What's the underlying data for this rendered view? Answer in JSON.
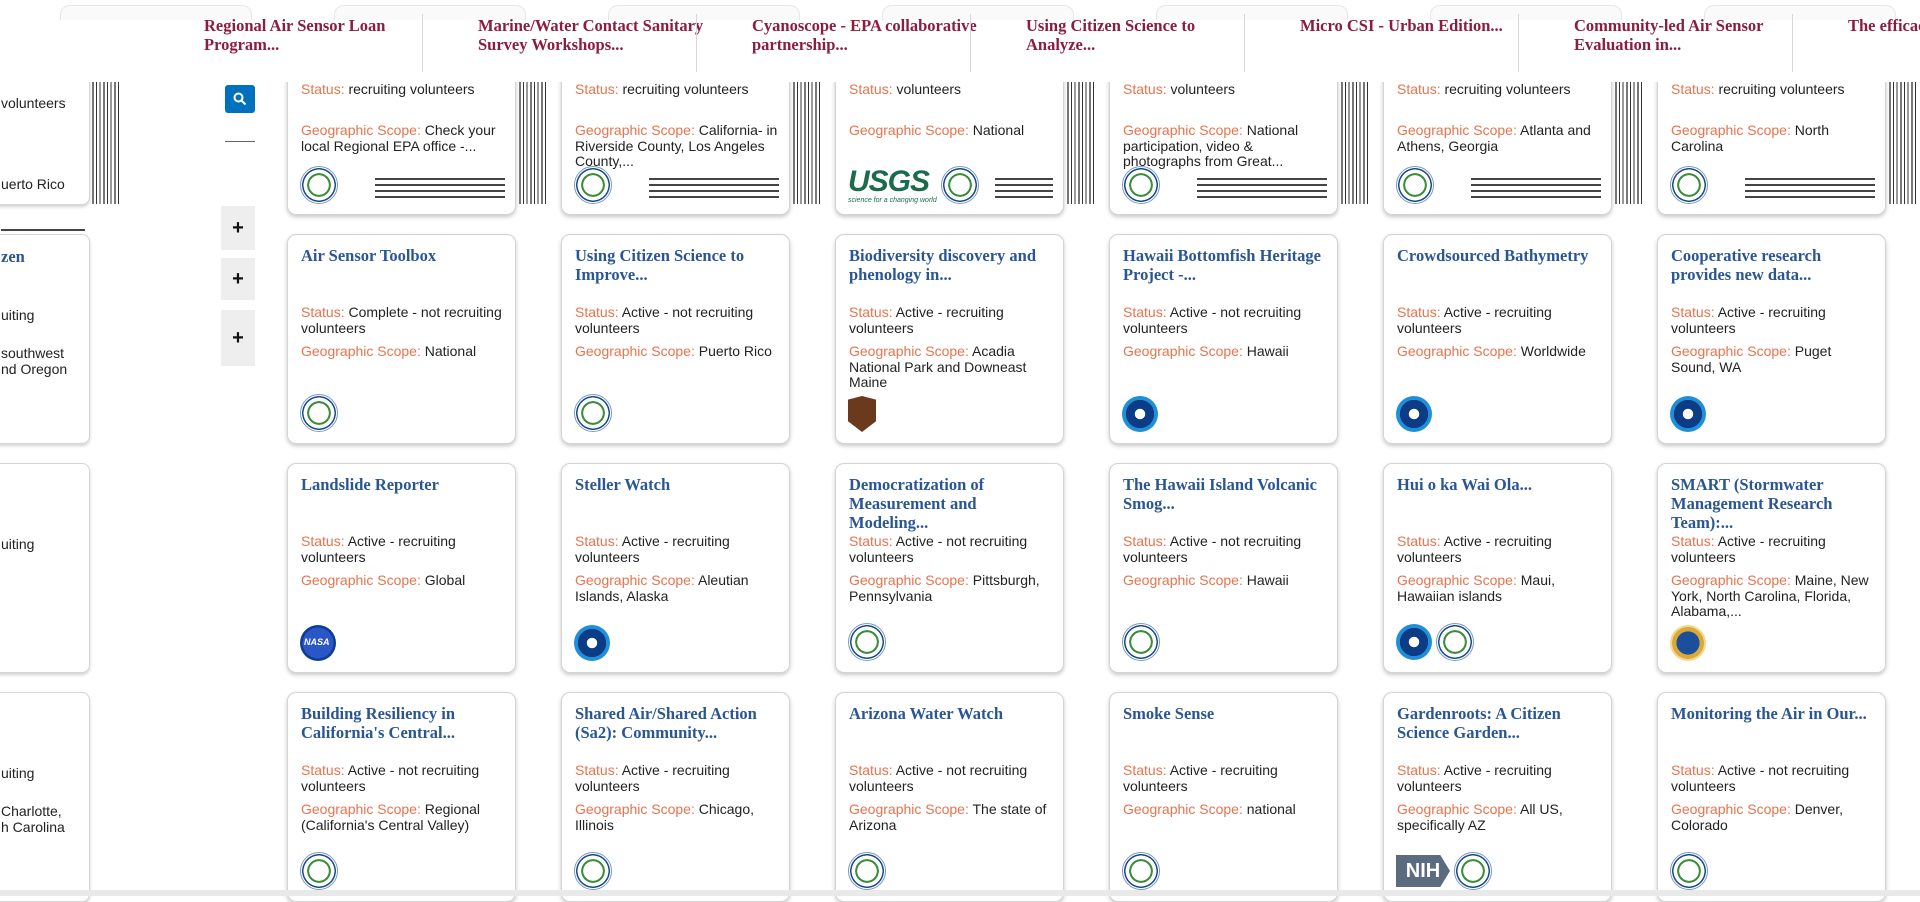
{
  "top_titles": [
    "Regional Air Sensor Loan Program...",
    "Marine/Water Contact Sanitary Survey Workshops...",
    "Cyanoscope - EPA collaborative partnership...",
    "Using Citizen Science to Analyze...",
    "Micro CSI - Urban Edition...",
    "Community-led Air Sensor Evaluation in...",
    "The efficacy of science..."
  ],
  "labels": {
    "status": "Status:",
    "geo": "Geographic Scope:"
  },
  "left_column": {
    "row0": {
      "status_tail": "volunteers",
      "geo_tail": "uerto Rico"
    },
    "row1": {
      "title_tail": "zen",
      "status_tail": "uiting",
      "geo_line1": "southwest",
      "geo_line2": "nd Oregon"
    },
    "row2": {
      "status_tail": "uiting"
    },
    "row3": {
      "status_tail": "uiting",
      "geo_line1": "Charlotte,",
      "geo_line2": "h Carolina"
    }
  },
  "sidebar": {
    "plus": [
      "+",
      "+",
      "+"
    ]
  },
  "row0": [
    {
      "status": "recruiting volunteers",
      "geo": "Check your local Regional EPA office -...",
      "logos": [
        "epa"
      ]
    },
    {
      "status": "recruiting volunteers",
      "geo": "California- in Riverside County, Los Angeles County,...",
      "logos": [
        "epa"
      ]
    },
    {
      "status": "volunteers",
      "geo": "National",
      "logos": [
        "usgs",
        "epa"
      ]
    },
    {
      "status": "volunteers",
      "geo": "National participation, video & photographs from Great...",
      "logos": [
        "epa"
      ]
    },
    {
      "status": "recruiting volunteers",
      "geo": "Atlanta and Athens, Georgia",
      "logos": [
        "epa"
      ]
    },
    {
      "status": "recruiting volunteers",
      "geo": "North Carolina",
      "logos": [
        "epa"
      ]
    }
  ],
  "usgs": {
    "text": "USGS",
    "tagline": "science for a changing world"
  },
  "cards": [
    [
      {
        "title": "Air Sensor Toolbox",
        "status": "Complete - not recruiting volunteers",
        "geo": "National",
        "logos": [
          "epa"
        ]
      },
      {
        "title": "Using Citizen Science to Improve...",
        "status": "Active - not recruiting volunteers",
        "geo": "Puerto Rico",
        "logos": [
          "epa"
        ]
      },
      {
        "title": "Biodiversity discovery and phenology in...",
        "status": "Active - recruiting volunteers",
        "geo": "Acadia National Park and Downeast Maine",
        "logos": [
          "nps"
        ]
      },
      {
        "title": "Hawaii Bottomfish Heritage Project -...",
        "status": "Active - not recruiting volunteers",
        "geo": "Hawaii",
        "logos": [
          "noaa"
        ]
      },
      {
        "title": "Crowdsourced Bathymetry",
        "status": "Active - recruiting volunteers",
        "geo": "Worldwide",
        "logos": [
          "noaa"
        ]
      },
      {
        "title": "Cooperative research provides new data...",
        "status": "Active - recruiting volunteers",
        "geo": "Puget Sound, WA",
        "logos": [
          "noaa"
        ]
      }
    ],
    [
      {
        "title": "Landslide Reporter",
        "status": "Active - recruiting volunteers",
        "geo": "Global",
        "logos": [
          "nasa"
        ]
      },
      {
        "title": "Steller Watch",
        "status": "Active - recruiting volunteers",
        "geo": "Aleutian Islands, Alaska",
        "logos": [
          "noaa"
        ]
      },
      {
        "title": "Democratization of Measurement and Modeling...",
        "status": "Active - not recruiting volunteers",
        "geo": "Pittsburgh, Pennsylvania",
        "logos": [
          "epa"
        ]
      },
      {
        "title": "The Hawaii Island Volcanic Smog...",
        "status": "Active - not recruiting volunteers",
        "geo": "Hawaii",
        "logos": [
          "epa"
        ]
      },
      {
        "title": "Hui o ka Wai Ola...",
        "status": "Active - recruiting volunteers",
        "geo": "Maui, Hawaiian islands",
        "logos": [
          "noaa",
          "epa"
        ]
      },
      {
        "title": "SMART (Stormwater Management Research Team):...",
        "status": "Active - recruiting volunteers",
        "geo": "Maine, New York, North Carolina, Florida, Alabama,...",
        "logos": [
          "nsf"
        ]
      }
    ],
    [
      {
        "title": "Building Resiliency in California's Central...",
        "status": "Active - not recruiting volunteers",
        "geo": "Regional (California's Central Valley)",
        "logos": [
          "epa"
        ]
      },
      {
        "title": "Shared Air/Shared Action (Sa2): Community...",
        "status": "Active - recruiting volunteers",
        "geo": "Chicago, Illinois",
        "logos": [
          "epa"
        ]
      },
      {
        "title": "Arizona Water Watch",
        "status": "Active - not recruiting volunteers",
        "geo": "The state of Arizona",
        "logos": [
          "epa"
        ]
      },
      {
        "title": "Smoke Sense",
        "status": "Active - recruiting volunteers",
        "geo": "national",
        "logos": [
          "epa"
        ]
      },
      {
        "title": "Gardenroots: A Citizen Science Garden...",
        "status": "Active - recruiting volunteers",
        "geo": "All US, specifically AZ",
        "logos": [
          "nih",
          "epa"
        ]
      },
      {
        "title": "Monitoring the Air in Our...",
        "status": "Active - not recruiting volunteers",
        "geo": "Denver, Colorado",
        "logos": [
          "epa"
        ]
      }
    ]
  ],
  "nih": {
    "text": "NIH"
  },
  "colors": {
    "title": "#2a5693",
    "label": "#e8734d",
    "top_title": "#8c1d3f",
    "search": "#0071bc"
  }
}
